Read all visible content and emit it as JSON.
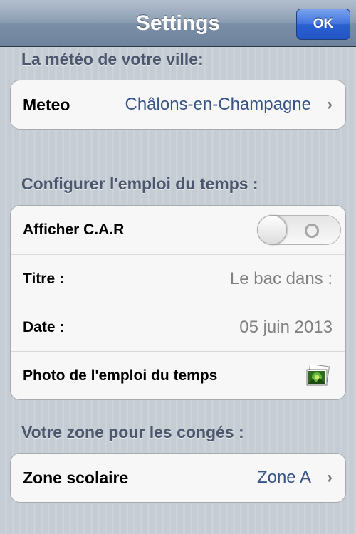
{
  "navbar": {
    "title": "Settings",
    "ok_label": "OK"
  },
  "weather_section": {
    "header": "La météo de votre ville:",
    "row": {
      "label": "Meteo",
      "value": "Châlons-en-Champagne"
    }
  },
  "schedule_section": {
    "header": "Configurer l'emploi du temps :",
    "toggle_row": {
      "label": "Afficher C.A.R",
      "state": "off"
    },
    "title_row": {
      "label": "Titre :",
      "value": "Le bac dans :"
    },
    "date_row": {
      "label": "Date :",
      "value": "05 juin 2013"
    },
    "photo_row": {
      "label": "Photo de l'emploi du temps",
      "icon": "photo-thumbnail-icon"
    }
  },
  "holiday_section": {
    "header": "Votre zone pour les congés :",
    "row": {
      "label": "Zone scolaire",
      "value": "Zone A"
    }
  },
  "colors": {
    "accent_blue": "#2a60d2",
    "value_blue": "#385487",
    "header_text": "#4c566c"
  }
}
